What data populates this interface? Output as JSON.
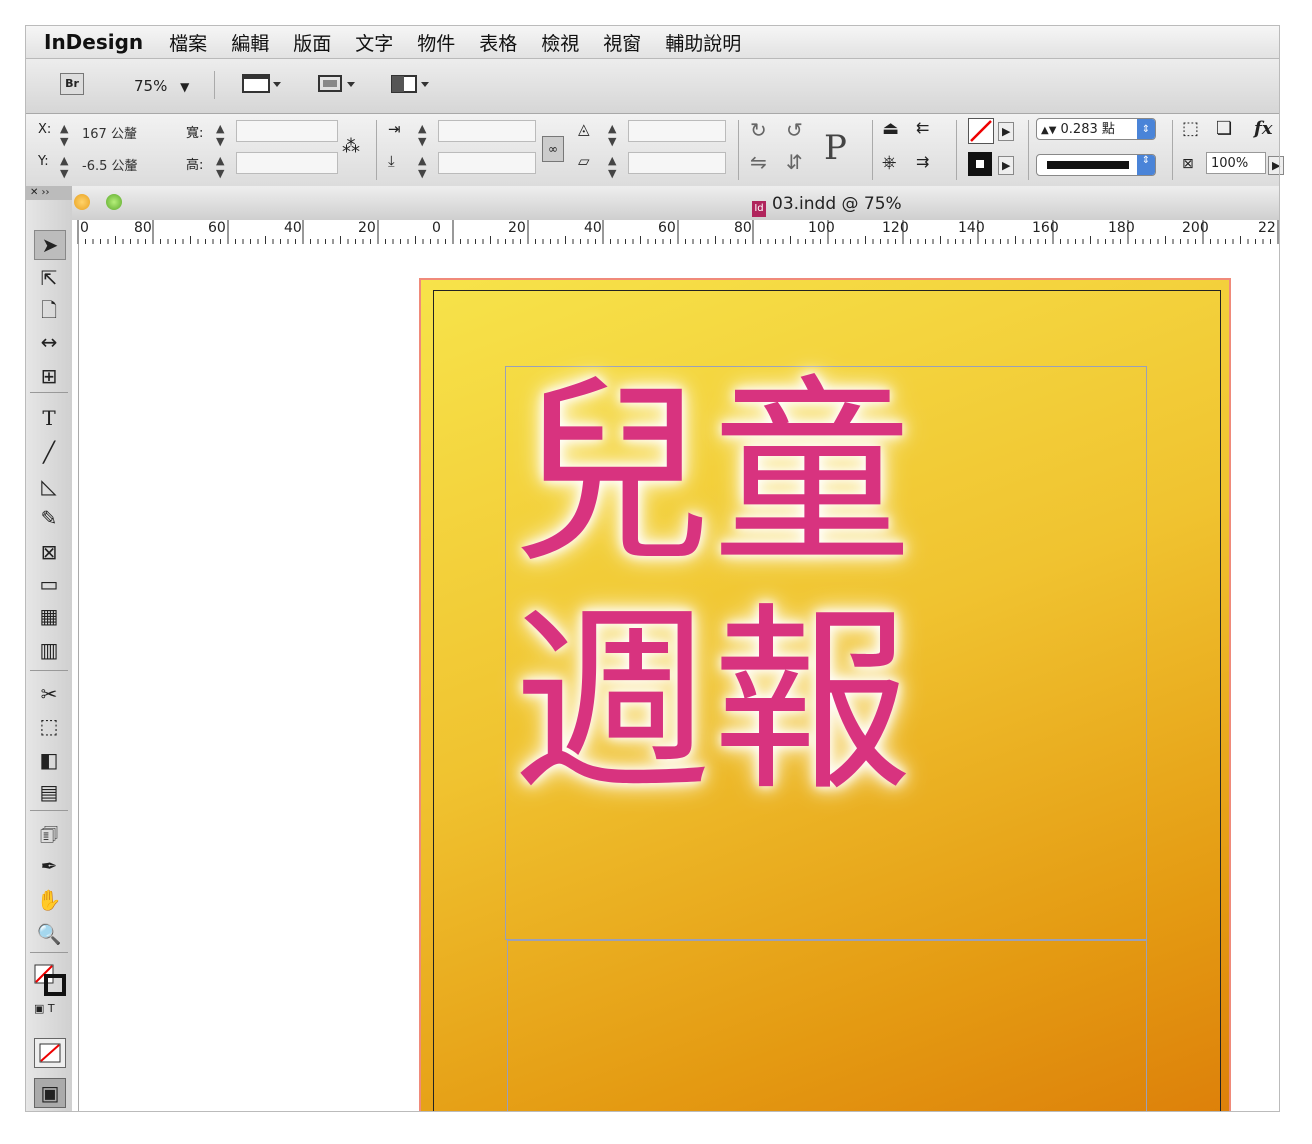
{
  "menu": {
    "app_name": "InDesign",
    "items": [
      "檔案",
      "編輯",
      "版面",
      "文字",
      "物件",
      "表格",
      "檢視",
      "視窗",
      "輔助說明"
    ]
  },
  "appbar": {
    "bridge_label": "Br",
    "zoom_value": "75%",
    "zoom_arrow": "▼"
  },
  "control": {
    "x_label": "X:",
    "x_value": "167 公釐",
    "y_label": "Y:",
    "y_value": "-6.5 公釐",
    "w_label": "寬:",
    "h_label": "高:",
    "stroke_weight": "0.283 點",
    "opacity": "100%",
    "p_glyph": "P",
    "fx_label": "fx"
  },
  "document": {
    "title": "03.indd @ 75%",
    "ruler_ticks": [
      "0",
      "80",
      "60",
      "40",
      "20",
      "0",
      "20",
      "40",
      "60",
      "80",
      "100",
      "120",
      "140",
      "160",
      "180",
      "200",
      "22"
    ]
  },
  "page_text": {
    "line1": "兒童",
    "line2": "週報"
  },
  "colors": {
    "headline": "#d8337f",
    "page_gradient_start": "#f7e34a",
    "page_gradient_end": "#dd800a"
  }
}
